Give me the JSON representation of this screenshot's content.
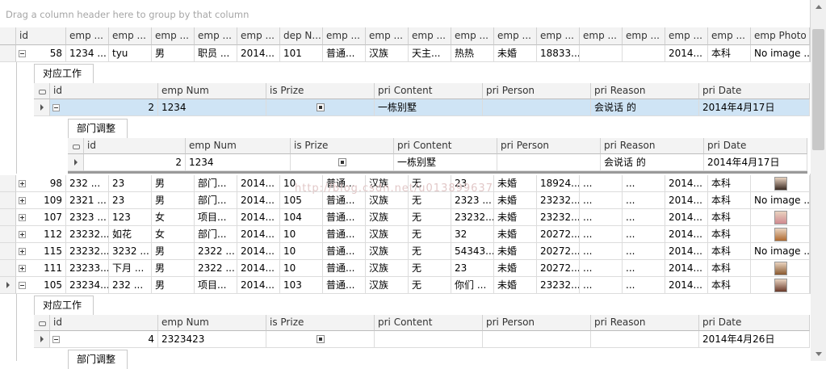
{
  "group_panel": {
    "hint": "Drag a column header here to group by that column"
  },
  "master_columns": [
    "id",
    "emp ...",
    "emp ...",
    "emp ...",
    "emp ...",
    "emp ...",
    "dep N...",
    "emp ...",
    "emp ...",
    "emp ...",
    "emp ...",
    "emp ...",
    "emp ...",
    "emp ...",
    "emp ...",
    "emp ...",
    "emp ...",
    "emp Photo"
  ],
  "master_row_1": [
    "58",
    "1234 ...",
    "tyu",
    "男",
    "职员 ...",
    "2014...",
    "101",
    "普通...",
    "汉族",
    "天主...",
    "热热",
    "未婚",
    "18833...",
    "",
    "",
    "2014...",
    "本科",
    "No image ..."
  ],
  "detail_1": {
    "tab": "对应工作",
    "columns": [
      "id",
      "emp Num",
      "is Prize",
      "pri Content",
      "pri Person",
      "pri Reason",
      "pri Date"
    ],
    "row": [
      "2",
      "1234",
      "",
      "一栋别墅",
      "",
      "会说话    的",
      "2014年4月17日"
    ],
    "nested": {
      "tab": "部门调整",
      "columns": [
        "id",
        "emp Num",
        "is Prize",
        "pri Content",
        "pri Person",
        "pri Reason",
        "pri Date"
      ],
      "row": [
        "2",
        "1234",
        "",
        "一栋别墅",
        "",
        "会说话    的",
        "2014年4月17日"
      ]
    }
  },
  "master_rows": [
    [
      "98",
      "232  ...",
      "23",
      "男",
      "部门...",
      "2014...",
      "10",
      "普通...",
      "汉族",
      "无",
      "23",
      "未婚",
      "18924...",
      "...",
      "...",
      "2014...",
      "本科",
      ""
    ],
    [
      "109",
      "2321 ...",
      "23",
      "男",
      "部门...",
      "2014...",
      "105",
      "普通...",
      "汉族",
      "无",
      "2323 ...",
      "未婚",
      "23232...",
      "...",
      "...",
      "2014...",
      "本科",
      "No image ..."
    ],
    [
      "107",
      "2323 ...",
      "123",
      "女",
      "项目...",
      "2014...",
      "104",
      "普通...",
      "汉族",
      "无",
      "23232...",
      "未婚",
      "23232...",
      "...",
      "...",
      "2014...",
      "本科",
      ""
    ],
    [
      "112",
      "23232...",
      "如花",
      "女",
      "部门...",
      "2014...",
      "10",
      "普通...",
      "汉族",
      "无",
      "32",
      "未婚",
      "20272...",
      "...",
      "...",
      "2014...",
      "本科",
      ""
    ],
    [
      "115",
      "23232...",
      "3232 ...",
      "男",
      "2322 ...",
      "2014...",
      "10",
      "普通...",
      "汉族",
      "无",
      "54343...",
      "未婚",
      "20272...",
      "...",
      "...",
      "2014...",
      "本科",
      "No image ..."
    ],
    [
      "111",
      "23233...",
      "下月 ...",
      "男",
      "2322 ...",
      "2014...",
      "10",
      "普通...",
      "汉族",
      "无",
      "23",
      "未婚",
      "20272...",
      "...",
      "...",
      "2014...",
      "本科",
      ""
    ],
    [
      "105",
      "23234...",
      "232  ...",
      "男",
      "项目...",
      "2014...",
      "103",
      "普通...",
      "汉族",
      "无",
      "你们 ...",
      "未婚",
      "23232...",
      "...",
      "...",
      "2014...",
      "本科",
      ""
    ]
  ],
  "detail_2": {
    "tab": "对应工作",
    "columns": [
      "id",
      "emp Num",
      "is Prize",
      "pri Content",
      "pri Person",
      "pri Reason",
      "pri Date"
    ],
    "row": [
      "4",
      "2323423",
      "",
      "",
      "",
      "",
      "2014年4月26日"
    ],
    "nested_tab": "部门调整"
  },
  "watermark": "http://blog.csdn.net/u013899637",
  "icons": {
    "expand": "expand-plus-icon",
    "collapse": "collapse-minus-icon",
    "current_row": "row-indicator-arrow-icon"
  }
}
